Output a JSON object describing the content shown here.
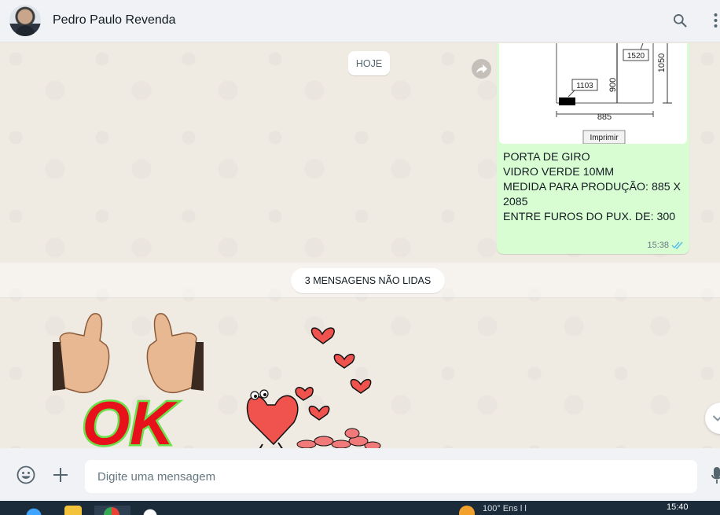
{
  "header": {
    "contact_name": "Pedro Paulo Revenda"
  },
  "chat": {
    "date_chip": "HOJE",
    "outgoing_message": {
      "drawing": {
        "dim_1520": "1520",
        "dim_1050": "1050",
        "dim_900": "900",
        "dim_1103": "1103",
        "dim_885": "885",
        "print_label": "Imprimir"
      },
      "lines": [
        "PORTA DE GIRO",
        "VIDRO VERDE 10MM",
        "MEDIDA PARA PRODUÇÃO: 885 X",
        "2085",
        "ENTRE FUROS DO PUX. DE: 300"
      ],
      "time": "15:38"
    },
    "unread_label": "3 MENSAGENS NÃO LIDAS",
    "sticker_ok_text": "OK"
  },
  "composer": {
    "placeholder": "Digite uma mensagem"
  },
  "taskbar": {
    "tray_text": "100°  Ens  l   l   ",
    "clock_time": "15:40"
  },
  "colors": {
    "chat_bg": "#efeae2",
    "outgoing_bubble": "#d9fdd3",
    "header_bg": "#f0f2f5",
    "read_ticks": "#53bdeb"
  }
}
